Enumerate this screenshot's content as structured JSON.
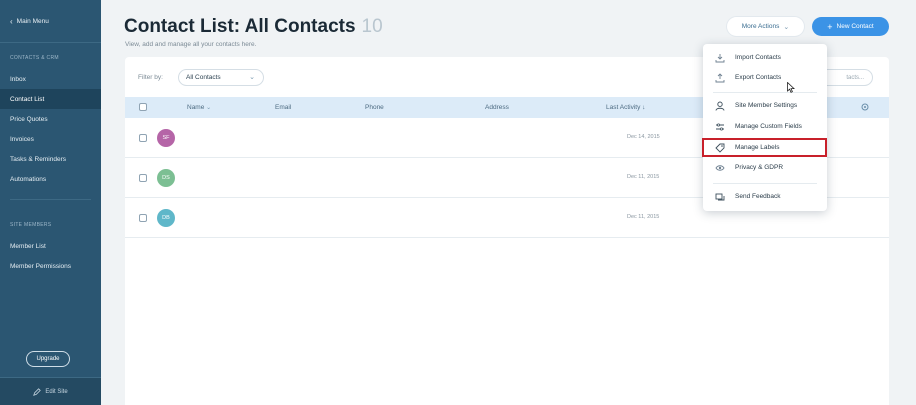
{
  "sidebar": {
    "back_label": "Main Menu",
    "section1": "CONTACTS & CRM",
    "items1": [
      {
        "label": "Inbox"
      },
      {
        "label": "Contact List"
      },
      {
        "label": "Price Quotes"
      },
      {
        "label": "Invoices"
      },
      {
        "label": "Tasks & Reminders"
      },
      {
        "label": "Automations"
      }
    ],
    "section2": "SITE MEMBERS",
    "items2": [
      {
        "label": "Member List"
      },
      {
        "label": "Member Permissions"
      }
    ],
    "upgrade_label": "Upgrade",
    "edit_site_label": "Edit Site"
  },
  "header": {
    "title": "Contact List: All Contacts",
    "count": "10",
    "subtitle": "View, add and manage all your contacts here.",
    "more_actions_label": "More Actions",
    "new_contact_label": "New Contact"
  },
  "filter": {
    "label": "Filter by:",
    "selected": "All Contacts",
    "search_placeholder": "tacts..."
  },
  "table": {
    "columns": [
      "Name",
      "Email",
      "Phone",
      "Address",
      "Last Activity"
    ],
    "rows": [
      {
        "initials": "SF",
        "color": "#b565a7",
        "date": "Dec 14, 2015"
      },
      {
        "initials": "DS",
        "color": "#7cbf93",
        "date": "Dec 11, 2015"
      },
      {
        "initials": "DB",
        "color": "#5fb7c9",
        "date": "Dec 11, 2015"
      }
    ]
  },
  "menu": {
    "items": [
      {
        "label": "Import Contacts",
        "icon": "import-icon"
      },
      {
        "label": "Export Contacts",
        "icon": "export-icon"
      },
      {
        "label": "Site Member Settings",
        "icon": "person-icon"
      },
      {
        "label": "Manage Custom Fields",
        "icon": "sliders-icon"
      },
      {
        "label": "Manage Labels",
        "icon": "tag-icon"
      },
      {
        "label": "Privacy & GDPR",
        "icon": "eye-icon"
      },
      {
        "label": "Send Feedback",
        "icon": "feedback-icon"
      }
    ]
  },
  "colors": {
    "sidebar": "#2b5672",
    "primary": "#3b93e6",
    "highlight": "#c8202a"
  }
}
